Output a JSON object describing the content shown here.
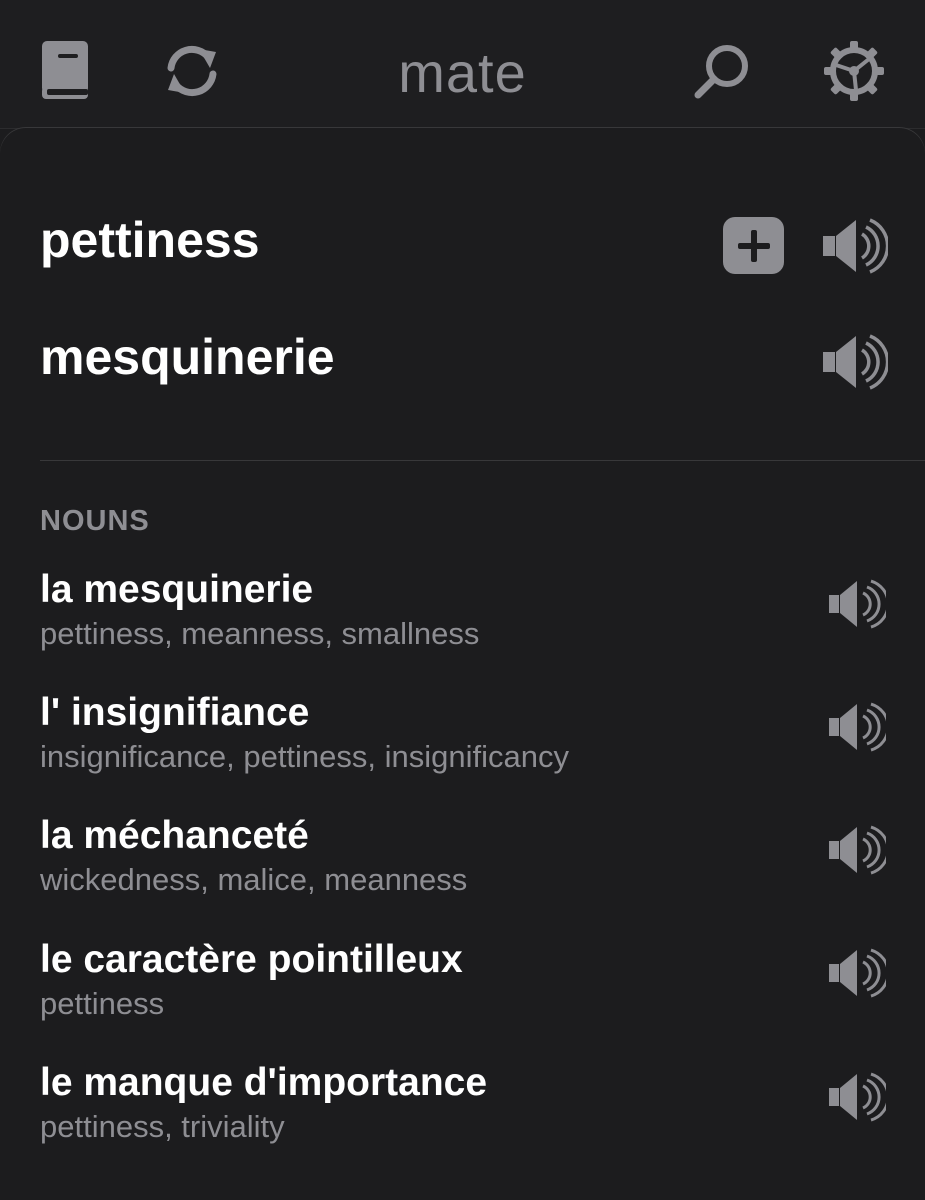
{
  "toolbar": {
    "title": "mate",
    "icons": [
      "book-icon",
      "sync-icon",
      "search-icon",
      "gear-icon"
    ]
  },
  "card": {
    "source_word": "pettiness",
    "target_word": "mesquinerie"
  },
  "section": {
    "label": "NOUNS"
  },
  "entries": [
    {
      "term": "la mesquinerie",
      "translations": "pettiness, meanness, smallness"
    },
    {
      "term": "l' insignifiance",
      "translations": "insignificance, pettiness, insignificancy"
    },
    {
      "term": "la méchanceté",
      "translations": "wickedness, malice, meanness"
    },
    {
      "term": "le caractère pointilleux",
      "translations": "pettiness"
    },
    {
      "term": "le manque d'importance",
      "translations": "pettiness, triviality"
    }
  ],
  "colors": {
    "background": "#1c1c1e",
    "primary_text": "#ffffff",
    "secondary_text": "#8e8e93",
    "icon": "#8e8e93"
  }
}
